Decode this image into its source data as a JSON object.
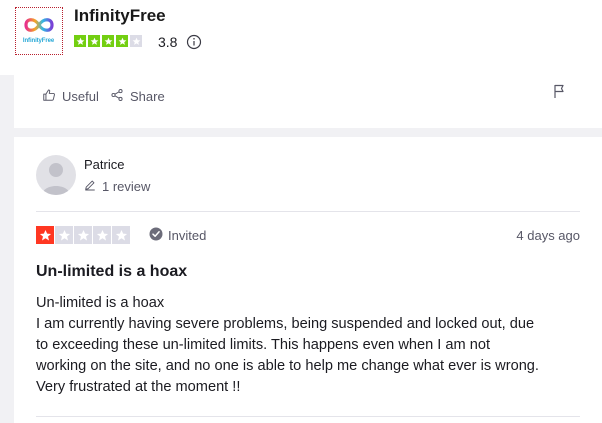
{
  "company": {
    "name": "InfinityFree",
    "logo_text": "InfinityFree",
    "rating": "3.8",
    "stars_filled": 4,
    "stars_total": 5,
    "star_color": "#73cf11",
    "info_icon": "info-icon"
  },
  "previous_review_actions": {
    "useful_label": "Useful",
    "share_label": "Share",
    "flag_icon": "flag-icon"
  },
  "review": {
    "reviewer_name": "Patrice",
    "review_count": "1 review",
    "stars_filled": 1,
    "stars_total": 5,
    "star_color": "#ff3722",
    "badge_label": "Invited",
    "date": "4 days ago",
    "title": "Un-limited is a hoax",
    "body_lines": [
      "Un-limited is a hoax",
      "I am currently having severe problems, being suspended and locked out, due",
      "to exceeding these un-limited limits. This happens even when I am not",
      "working on the site, and no one is able to help me change what ever is wrong.",
      "Very frustrated at the moment !!"
    ]
  }
}
